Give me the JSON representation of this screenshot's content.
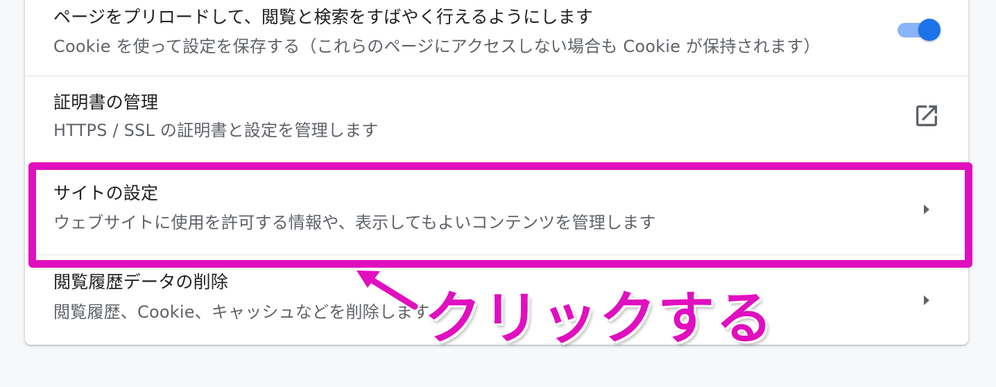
{
  "settings": {
    "preload": {
      "title": "ページをプリロードして、閲覧と検索をすばやく行えるようにします",
      "description": "Cookie を使って設定を保存する（これらのページにアクセスしない場合も Cookie が保持されます）",
      "toggle_on": true
    },
    "certificates": {
      "title": "証明書の管理",
      "description": "HTTPS / SSL の証明書と設定を管理します",
      "icon": "open-in-new-icon"
    },
    "site_settings": {
      "title": "サイトの設定",
      "description": "ウェブサイトに使用を許可する情報や、表示してもよいコンテンツを管理します",
      "icon": "chevron-right-icon"
    },
    "clear_data": {
      "title": "閲覧履歴データの削除",
      "description": "閲覧履歴、Cookie、キャッシュなどを削除します",
      "icon": "chevron-right-icon"
    }
  },
  "annotation": {
    "text": "クリックする",
    "icon": "pointer-arrow-icon"
  },
  "colors": {
    "accent": "#1a73e8",
    "accent_light": "#8ab4f8",
    "annotation": "#e00fbf",
    "title_text": "#202124",
    "secondary_text": "#5f6368",
    "icon": "#5f6368",
    "background": "#f7f8fa"
  }
}
